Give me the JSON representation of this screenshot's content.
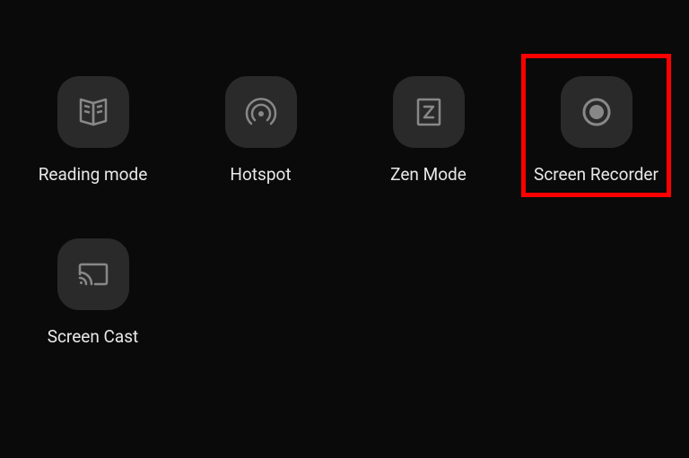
{
  "tiles": [
    {
      "label": "Reading mode",
      "icon": "reading-mode-icon",
      "highlighted": false
    },
    {
      "label": "Hotspot",
      "icon": "hotspot-icon",
      "highlighted": false
    },
    {
      "label": "Zen Mode",
      "icon": "zen-mode-icon",
      "highlighted": false
    },
    {
      "label": "Screen Recorder",
      "icon": "screen-recorder-icon",
      "highlighted": true
    },
    {
      "label": "Screen Cast",
      "icon": "screen-cast-icon",
      "highlighted": false
    }
  ],
  "colors": {
    "background": "#0a0a0a",
    "tile_bg": "#2a2a2a",
    "icon": "#888888",
    "label": "#e8e8e8",
    "highlight": "#ff0000"
  }
}
